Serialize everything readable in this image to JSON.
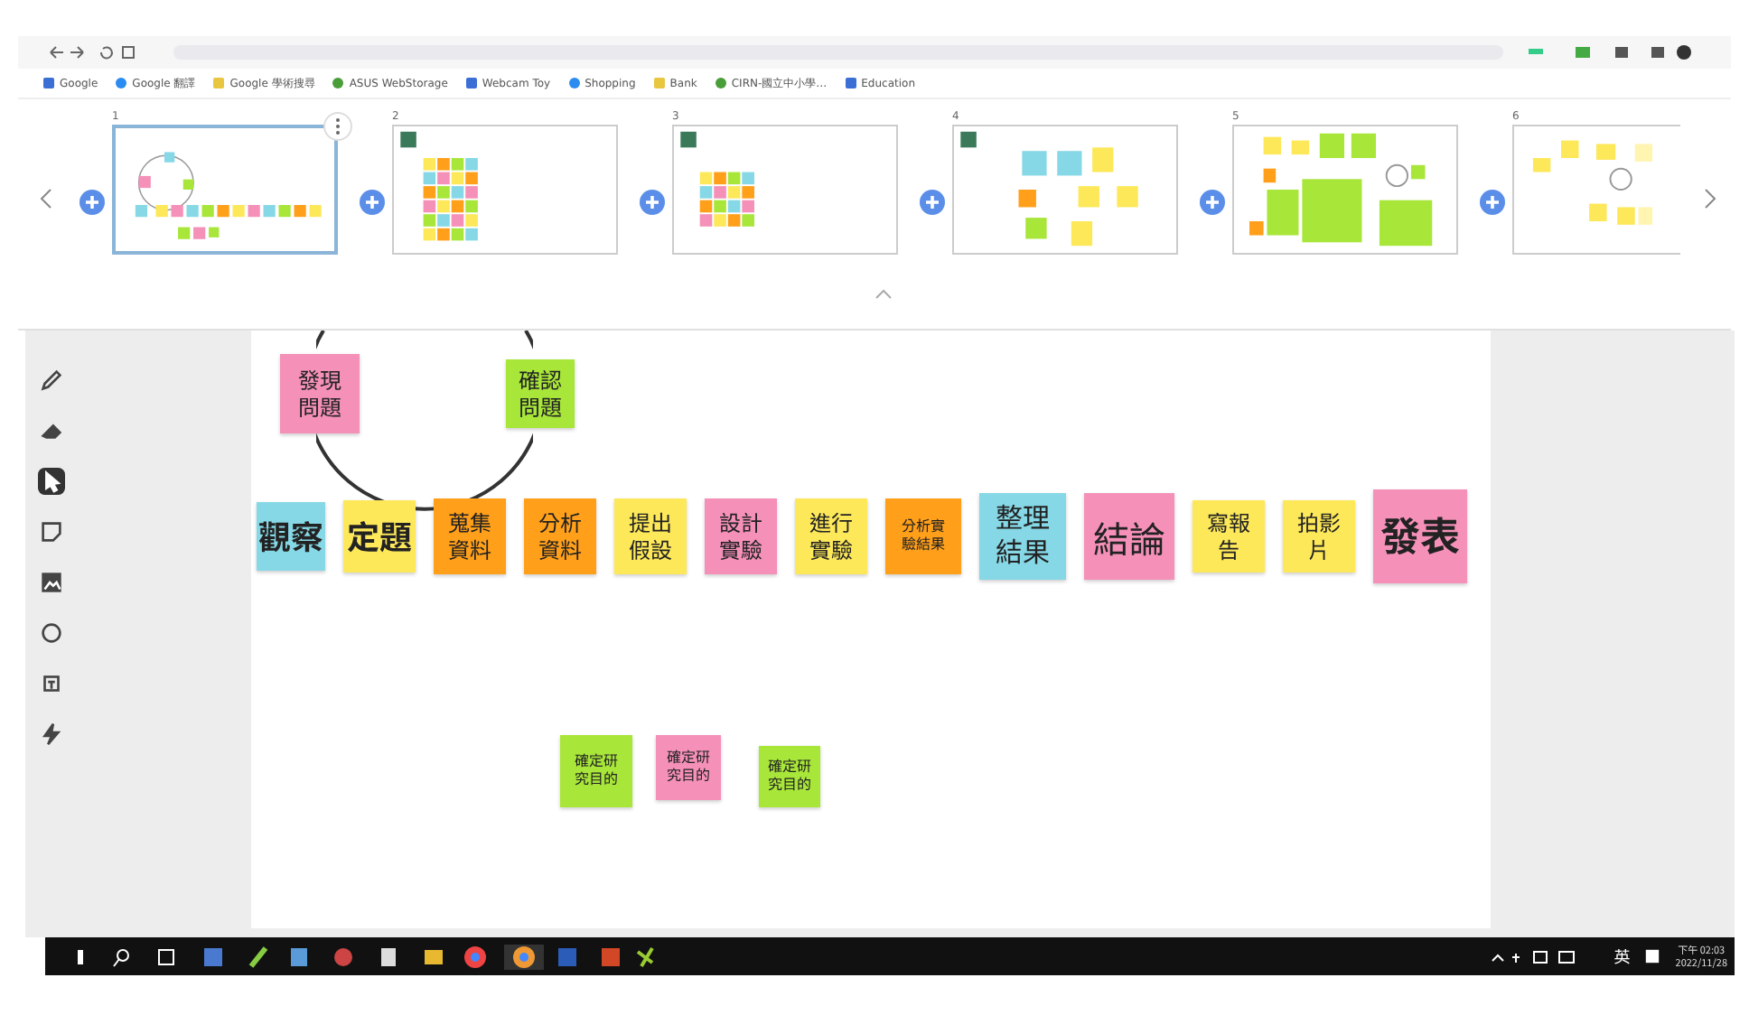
{
  "bookmarks": [
    {
      "label": "Google"
    },
    {
      "label": "Google 翻譯"
    },
    {
      "label": "Google 學術搜尋"
    },
    {
      "label": "ASUS WebStorage"
    },
    {
      "label": "Webcam Toy"
    },
    {
      "label": "Shopping"
    },
    {
      "label": "Bank"
    },
    {
      "label": "CIRN-國立中小學…"
    },
    {
      "label": "Education"
    }
  ],
  "frames": [
    {
      "number": "1",
      "selected": true
    },
    {
      "number": "2",
      "selected": false
    },
    {
      "number": "3",
      "selected": false
    },
    {
      "number": "4",
      "selected": false
    },
    {
      "number": "5",
      "selected": false
    },
    {
      "number": "6",
      "selected": false
    }
  ],
  "tools": [
    {
      "selected": false
    },
    {
      "selected": false
    },
    {
      "selected": true
    },
    {
      "selected": false
    },
    {
      "selected": false
    },
    {
      "selected": false
    },
    {
      "selected": false
    },
    {
      "selected": false
    }
  ],
  "cycle_notes": [
    {
      "text": "發現問題",
      "color": "#f590b8"
    },
    {
      "text": "確認問題",
      "color": "#a8e63a"
    }
  ],
  "main_notes": [
    {
      "text": "觀察",
      "color": "#86d8e6"
    },
    {
      "text": "定題",
      "color": "#fde85a"
    },
    {
      "text": "蒐集資料",
      "color": "#ff9f1a"
    },
    {
      "text": "分析資料",
      "color": "#ff9f1a"
    },
    {
      "text": "提出假設",
      "color": "#fde85a"
    },
    {
      "text": "設計實驗",
      "color": "#f590b8"
    },
    {
      "text": "進行實驗",
      "color": "#fde85a"
    },
    {
      "text": "分析實驗結果",
      "color": "#ff9f1a"
    },
    {
      "text": "整理結果",
      "color": "#86d8e6"
    },
    {
      "text": "結論",
      "color": "#f590b8"
    },
    {
      "text": "寫報告",
      "color": "#fde85a"
    },
    {
      "text": "拍影片",
      "color": "#fde85a"
    },
    {
      "text": "發表",
      "color": "#f590b8"
    }
  ],
  "bottom_notes": [
    {
      "text": "確定研究目的",
      "color": "#a8e63a"
    },
    {
      "text": "確定研究目的",
      "color": "#f590b8"
    },
    {
      "text": "確定研究目的",
      "color": "#a8e63a"
    }
  ],
  "taskbar": {
    "ime": "英",
    "time": "下午 02:03",
    "date": "2022/11/28"
  }
}
